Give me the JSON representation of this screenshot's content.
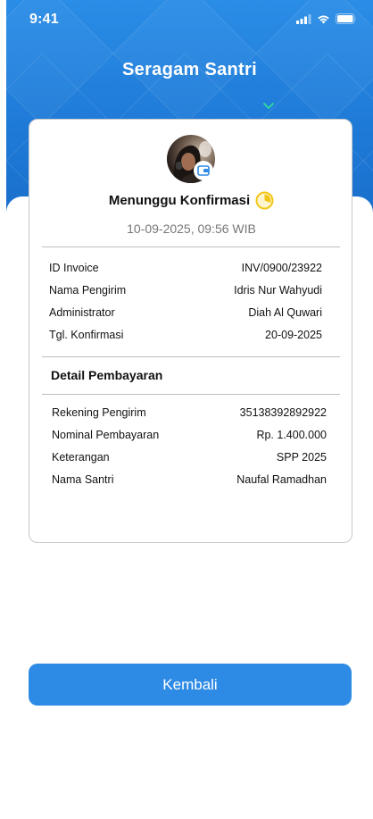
{
  "status_bar": {
    "time": "9:41"
  },
  "header": {
    "title": "Seragam Santri"
  },
  "card": {
    "status": "Menunggu Konfirmasi",
    "timestamp": "10-09-2025, 09:56 WIB",
    "rows": [
      {
        "label": "ID Invoice",
        "value": "INV/0900/23922"
      },
      {
        "label": "Nama Pengirim",
        "value": "Idris Nur Wahyudi"
      },
      {
        "label": "Administrator",
        "value": "Diah Al Quwari"
      },
      {
        "label": "Tgl. Konfirmasi",
        "value": "20-09-2025"
      }
    ],
    "payment_section_title": "Detail Pembayaran",
    "payment_rows": [
      {
        "label": "Rekening Pengirim",
        "value": "35138392892922"
      },
      {
        "label": "Nominal Pembayaran",
        "value": "Rp. 1.400.000"
      },
      {
        "label": "Keterangan",
        "value": "SPP 2025"
      },
      {
        "label": "Nama Santri",
        "value": "Naufal Ramadhan"
      }
    ]
  },
  "actions": {
    "back_label": "Kembali"
  },
  "colors": {
    "primary": "#2d8ae5",
    "header_gradient_top": "#2a8de6",
    "pending_icon": "#f2c617",
    "chevron": "#2fd3a4"
  },
  "icons": {
    "status_pending": "clock-pending-icon",
    "avatar_badge": "wallet-icon",
    "header_toggle": "chevron-down-icon"
  }
}
